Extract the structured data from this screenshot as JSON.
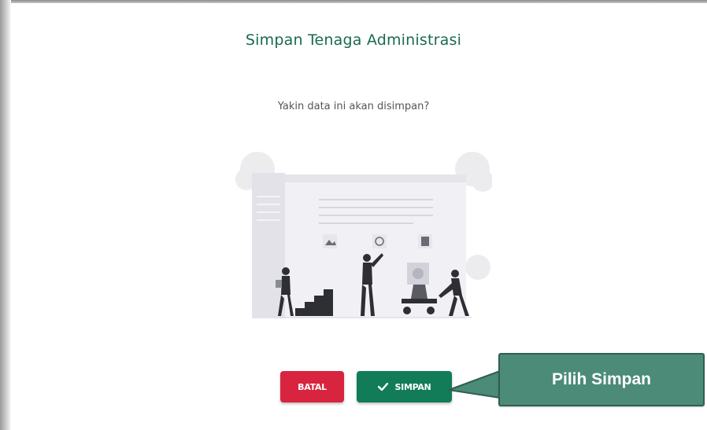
{
  "dialog": {
    "title": "Simpan Tenaga Administrasi",
    "message": "Yakin data ini akan disimpan?"
  },
  "buttons": {
    "cancel_label": "BATAL",
    "save_label": "SIMPAN",
    "save_icon": "check-icon"
  },
  "callout": {
    "text": "Pilih Simpan"
  },
  "colors": {
    "title": "#1a6b4c",
    "cancel": "#d8243f",
    "save": "#127c58",
    "callout": "#4b8b78"
  },
  "illustration": {
    "name": "website-construction-illustration"
  }
}
